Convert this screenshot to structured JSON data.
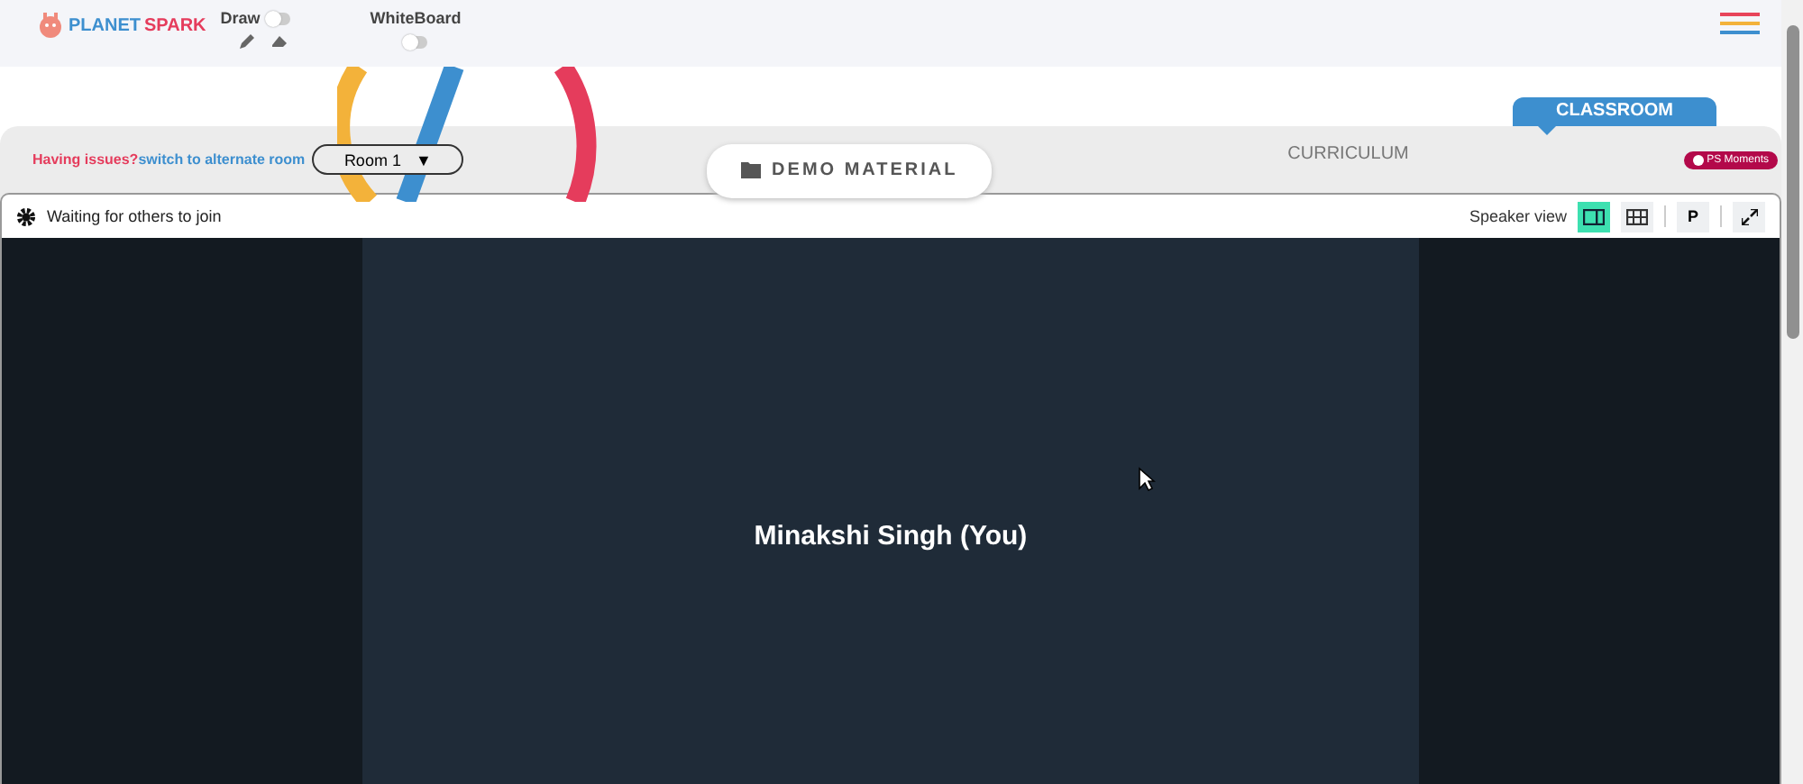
{
  "header": {
    "logo": {
      "first": "PLANET",
      "second": "SPARK"
    },
    "draw": {
      "label": "Draw",
      "on": false
    },
    "whiteboard": {
      "label": "WhiteBoard",
      "on": false
    }
  },
  "issues": {
    "question": "Having issues?",
    "link": "switch to alternate room"
  },
  "room_select": {
    "value": "Room 1",
    "caret": "▼"
  },
  "tabs": [
    {
      "label": "DEMO MATERIAL",
      "kind": "pill",
      "selected": false
    },
    {
      "label": "CURRICULUM",
      "kind": "plain",
      "selected": false
    },
    {
      "label": "CLASSROOM",
      "kind": "flag",
      "selected": true
    }
  ],
  "badge": "PS Moments",
  "call": {
    "status": "Waiting for others to join",
    "view_label": "Speaker view",
    "views": [
      {
        "kind": "speaker",
        "selected": true
      },
      {
        "kind": "grid",
        "selected": false
      }
    ],
    "p_button": "P",
    "participant": "Minakshi Singh (You)"
  }
}
